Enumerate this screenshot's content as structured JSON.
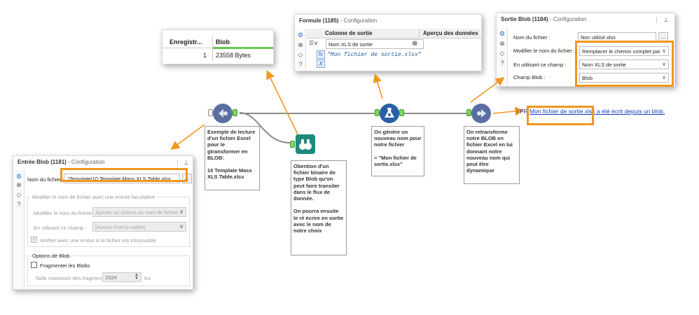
{
  "blob_grid": {
    "headers": [
      "Enregistr...",
      "Blob"
    ],
    "rows": [
      {
        "record": "1",
        "blob": "23558 Bytes"
      }
    ]
  },
  "formula_panel": {
    "title": "Formule (1185)",
    "subtitle": " - Configuration",
    "col_output": "Colonne de sortie",
    "col_preview": "Aperçu des données",
    "output_field": "Nom XLS de sortie",
    "expression": "\"Mon fichier de sortie.xlsx\""
  },
  "blob_output_panel": {
    "title": "Sortie Blob (1184)",
    "subtitle": " - Configuration",
    "file_label": "Nom du fichier :",
    "file_value": "Non utilisé.xlsx",
    "modify_label": "Modifier le nom du fichier :",
    "modify_value": "Remplacer le chemin complet par u",
    "using_label": "En utilisant ce champ :",
    "using_value": "Nom XLS de sortie",
    "blob_label": "Champ Blob :",
    "blob_value": "Blob"
  },
  "blob_input_panel": {
    "title": "Entrée Blob (1181)",
    "subtitle": " - Configuration",
    "file_label": "Nom du fichier :",
    "file_value": ".\\Template\\10 Template Mass XLS Table.xlsx",
    "optional_group": "Modifier le nom de fichier avec une entrée facultative",
    "modify_label": "Modifier le nom du fichier :",
    "modify_value": "Ajouter un champ au nom de fichier",
    "using_label": "En utilisant ce champ :",
    "using_value": "[Aucun champ valide]",
    "stop_label": "Arrêter avec une erreur si le fichier est introuvable",
    "blob_options": "Options de Blob",
    "fragment_label": "Fragmenter les Blobs",
    "fragment_size_label": "Taille maximum des fragments :",
    "fragment_size_value": "1024",
    "fragment_unit": "Ko"
  },
  "messages": {
    "info_prefix": "i FR",
    "info_link": "Mon fichier de sortie.xlsx",
    "info_suffix": " a été écrit depuis un blob."
  },
  "notes": {
    "input": "Exemple de lecture d'un fichier Excel pour le gtransformer en BLOB:\n\n10 Template Mass XLS Table.xlsx",
    "browse": "Obention d'un fichier binaire de type Blob qu'on peut faire transiter dans le flux de donnée.\n\nOn pourra ensuite le ré écrire en sortie avec le nom de notre choix",
    "formula": "On génère un nouveau nom pour notre fichier\n\n= \"Mon fichier de sortie.xlsx\"",
    "output": "On retransforme notre BLOB en fichier Excel en lui donnant notre nouveau nom qui peut être dynamique"
  },
  "colors": {
    "accent": "#f0961f",
    "blob_node": "#5a6fa0",
    "browse_node": "#1f8a7a",
    "formula_node": "#2a5fa8",
    "link": "#1a3dbf"
  }
}
